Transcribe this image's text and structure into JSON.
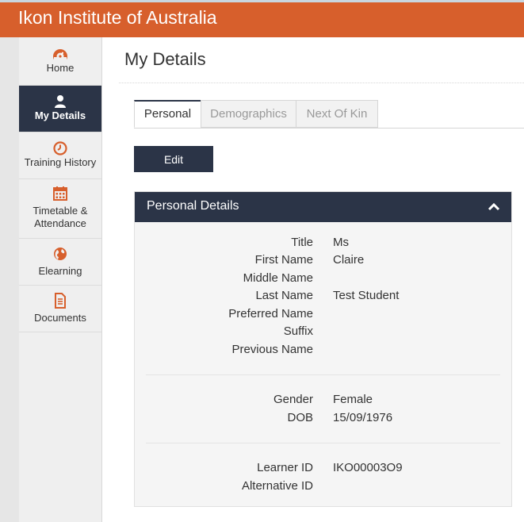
{
  "header": {
    "title": "Ikon Institute of Australia"
  },
  "sidebar": {
    "items": [
      {
        "label": "Home",
        "icon": "dashboard-icon"
      },
      {
        "label": "My Details",
        "icon": "user-icon"
      },
      {
        "label": "Training History",
        "icon": "clock-icon"
      },
      {
        "label": "Timetable & Attendance",
        "icon": "calendar-icon"
      },
      {
        "label": "Elearning",
        "icon": "globe-icon"
      },
      {
        "label": "Documents",
        "icon": "document-icon"
      }
    ],
    "active": "My Details"
  },
  "main": {
    "title": "My Details",
    "tabs": [
      {
        "label": "Personal"
      },
      {
        "label": "Demographics"
      },
      {
        "label": "Next Of Kin"
      }
    ],
    "active_tab": "Personal",
    "edit_label": "Edit"
  },
  "panel": {
    "title": "Personal Details",
    "groups": [
      [
        {
          "label": "Title",
          "value": "Ms"
        },
        {
          "label": "First Name",
          "value": "Claire"
        },
        {
          "label": "Middle Name",
          "value": ""
        },
        {
          "label": "Last Name",
          "value": "Test Student"
        },
        {
          "label": "Preferred Name",
          "value": ""
        },
        {
          "label": "Suffix",
          "value": ""
        },
        {
          "label": "Previous Name",
          "value": ""
        }
      ],
      [
        {
          "label": "Gender",
          "value": "Female"
        },
        {
          "label": "DOB",
          "value": "15/09/1976"
        }
      ],
      [
        {
          "label": "Learner ID",
          "value": "IKO00003O9"
        },
        {
          "label": "Alternative ID",
          "value": ""
        }
      ]
    ]
  },
  "colors": {
    "brand_orange": "#d75f2c",
    "navy": "#2b3447",
    "icon_orange": "#d75f2c"
  }
}
